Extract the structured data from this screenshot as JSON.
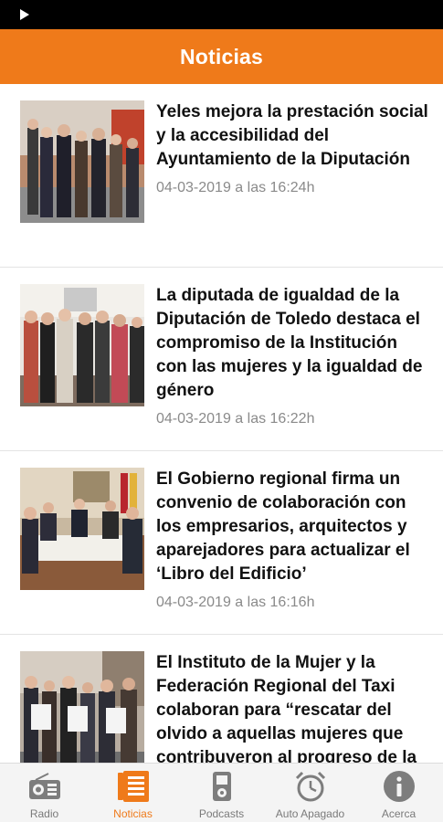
{
  "app": {
    "title": "Noticias"
  },
  "colors": {
    "accent": "#ef7a1a",
    "status_bar": "#000000",
    "date_text": "#8a8a8a",
    "nav_inactive": "#7a7a7a"
  },
  "news": [
    {
      "headline": "Yeles mejora la prestación social y la accesibilidad del Ayuntamiento de la Diputación",
      "date": "04-03-2019 a las 16:24h",
      "image_icon": "photo-group-indoor"
    },
    {
      "headline": "La diputada de igualdad de la Diputación de Toledo destaca el compromiso de la Institución con las mujeres y la igualdad de género",
      "date": "04-03-2019 a las 16:22h",
      "image_icon": "photo-group-women"
    },
    {
      "headline": "El Gobierno regional firma un convenio de colaboración con los empresarios, arquitectos y aparejadores para actualizar el ‘Libro del Edificio’",
      "date": "04-03-2019 a las 16:16h",
      "image_icon": "photo-meeting-table"
    },
    {
      "headline": "El Instituto de la Mujer y la Federación Regional del Taxi colaboran para “rescatar del olvido a aquellas mujeres que contribuyeron al progreso de la humanidad”",
      "date": "",
      "image_icon": "photo-group-posters"
    }
  ],
  "nav": [
    {
      "label": "Radio",
      "icon": "radio-icon",
      "active": false
    },
    {
      "label": "Noticias",
      "icon": "news-icon",
      "active": true
    },
    {
      "label": "Podcasts",
      "icon": "ipod-icon",
      "active": false
    },
    {
      "label": "Auto Apagado",
      "icon": "alarm-clock-icon",
      "active": false
    },
    {
      "label": "Acerca",
      "icon": "info-icon",
      "active": false
    }
  ]
}
